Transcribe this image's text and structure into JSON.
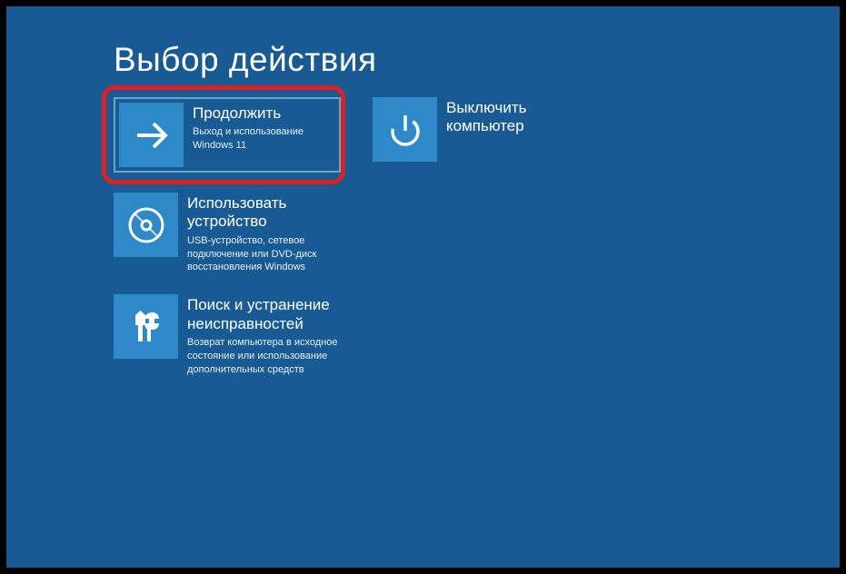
{
  "page": {
    "title": "Выбор действия"
  },
  "tiles": {
    "continue": {
      "title": "Продолжить",
      "subtitle": "Выход и использование Windows 11"
    },
    "shutdown": {
      "title": "Выключить компьютер"
    },
    "device": {
      "title": "Использовать устройство",
      "subtitle": "USB-устройство, сетевое подключение или DVD-диск восстановления Windows"
    },
    "troubleshoot": {
      "title": "Поиск и устранение неисправностей",
      "subtitle": "Возврат компьютера в исходное состояние или использование дополнительных средств"
    }
  }
}
